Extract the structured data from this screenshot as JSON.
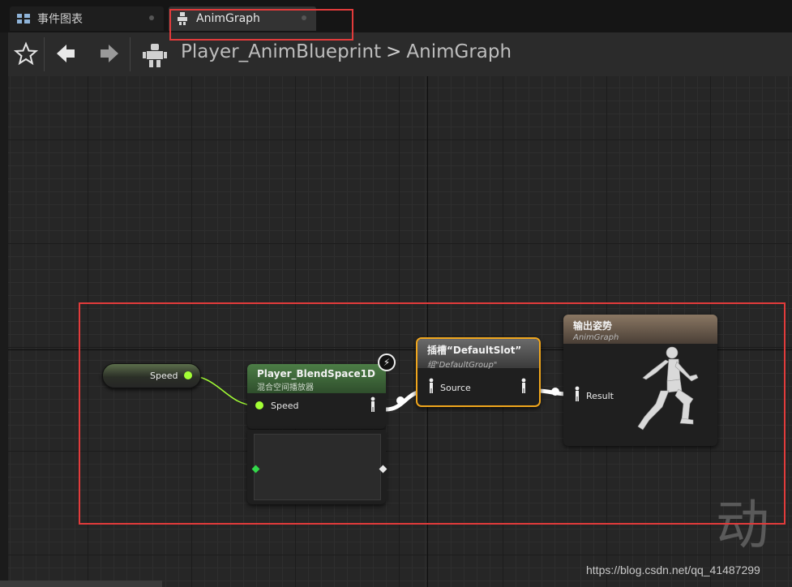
{
  "tabs": [
    {
      "label": "事件图表",
      "icon": "event-graph-icon",
      "active": false
    },
    {
      "label": "AnimGraph",
      "icon": "anim-graph-icon",
      "active": true
    }
  ],
  "toolbar": {
    "favorite_icon": "star-icon",
    "back_icon": "arrow-left-icon",
    "forward_icon": "arrow-right-icon",
    "blueprint_icon": "anim-blueprint-icon",
    "breadcrumb": {
      "root": "Player_AnimBlueprint",
      "separator": ">",
      "current": "AnimGraph"
    }
  },
  "graph": {
    "nodes": {
      "speed_var": {
        "label": "Speed",
        "pin_color": "#a3ff35"
      },
      "blendspace": {
        "title": "Player_BlendSpace1D",
        "subtitle": "混合空间播放器",
        "input_pin": "Speed",
        "header_color": "#4c7d46"
      },
      "slot": {
        "title": "插槽“DefaultSlot”",
        "subtitle": "组\"DefaultGroup\"",
        "input_pin": "Source",
        "border_color": "#f0a61d"
      },
      "output_pose": {
        "title": "输出姿势",
        "subtitle": "AnimGraph",
        "input_pin": "Result",
        "header_color": "#8a7763"
      }
    }
  },
  "annotations": {
    "highlight_color": "#e23b3b"
  },
  "watermark": {
    "glyph": "动",
    "url": "https://blog.csdn.net/qq_41487299"
  }
}
